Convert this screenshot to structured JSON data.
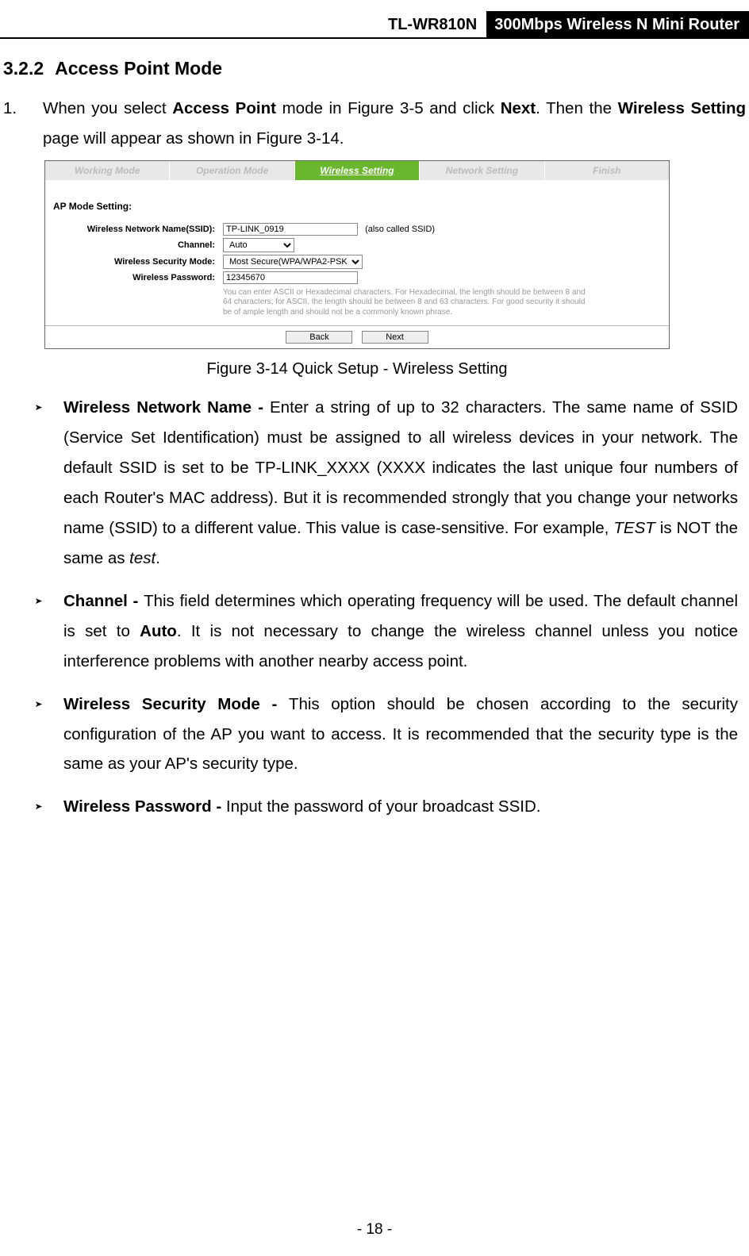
{
  "header": {
    "model": "TL-WR810N",
    "product": "300Mbps Wireless N Mini Router"
  },
  "section": {
    "number": "3.2.2",
    "title": "Access Point Mode"
  },
  "step": {
    "num": "1.",
    "text_before": "When you select ",
    "bold1": "Access Point",
    "text_mid1": " mode in Figure 3-5 and click ",
    "bold2": "Next",
    "text_mid2": ". Then the ",
    "bold3": "Wireless Setting",
    "text_after": " page will appear as shown in Figure 3-14."
  },
  "figure": {
    "tabs": [
      "Working Mode",
      "Operation Mode",
      "Wireless Setting",
      "Network Setting",
      "Finish"
    ],
    "active_tab": 2,
    "ap_heading": "AP Mode Setting:",
    "labels": {
      "ssid": "Wireless Network Name(SSID):",
      "channel": "Channel:",
      "security": "Wireless Security Mode:",
      "password": "Wireless Password:"
    },
    "values": {
      "ssid": "TP-LINK_0919",
      "ssid_note": "(also called SSID)",
      "channel": "Auto",
      "security": "Most Secure(WPA/WPA2-PSK)",
      "password": "12345670"
    },
    "pwd_help": "You can enter ASCII or Hexadecimal characters. For Hexadecimal, the length should be between 8 and 64 characters; for ASCII, the length should be between 8 and 63 characters. For good security it should be of ample length and should not be a commonly known phrase.",
    "buttons": {
      "back": "Back",
      "next": "Next"
    },
    "caption": "Figure 3-14 Quick Setup - Wireless Setting"
  },
  "bullets": [
    {
      "label": "Wireless Network Name - ",
      "body_parts": [
        {
          "t": "Enter a string of up to 32 characters. The same name of SSID (Service Set Identification) must be assigned to all wireless devices in your network. The default SSID is set to be TP-LINK_XXXX (XXXX indicates the last unique four numbers of each Router's MAC address). But it is recommended strongly that you change your networks name (SSID) to a different value. This value is case-sensitive. For example, "
        },
        {
          "i": "TEST"
        },
        {
          "t": " is NOT the same as "
        },
        {
          "i": "test"
        },
        {
          "t": "."
        }
      ]
    },
    {
      "label": "Channel - ",
      "body_parts": [
        {
          "t": "This field determines which operating frequency will be used. The default channel is set to "
        },
        {
          "b": "Auto"
        },
        {
          "t": ". It is not necessary to change the wireless channel unless you notice interference problems with another nearby access point."
        }
      ]
    },
    {
      "label": "Wireless Security Mode - ",
      "body_parts": [
        {
          "t": "This option should be chosen according to the security configuration of the AP you want to access. It is recommended that the security type is the same as your AP's security type."
        }
      ]
    },
    {
      "label": "Wireless Password - ",
      "body_parts": [
        {
          "t": "Input the password of your broadcast SSID."
        }
      ]
    }
  ],
  "page_number": "- 18 -"
}
